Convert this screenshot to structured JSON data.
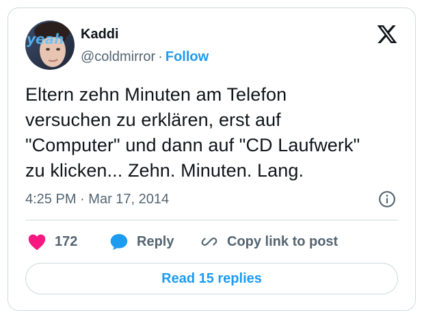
{
  "author": {
    "display_name": "Kaddi",
    "handle": "@coldmirror",
    "separator": "·",
    "follow_label": "Follow",
    "avatar_icon": "profile-photo",
    "avatar_text": "yeah"
  },
  "platform_icon": "x-logo-icon",
  "tweet": {
    "text": "Eltern zehn Minuten am Telefon\nversuchen zu erklären, erst auf\n\"Computer\" und dann auf \"CD Laufwerk\"\nzu klicken... Zehn. Minuten. Lang.",
    "time": "4:25 PM",
    "meta_separator": "·",
    "date": "Mar 17, 2014"
  },
  "actions": {
    "like_count": "172",
    "reply_label": "Reply",
    "copy_link_label": "Copy link to post"
  },
  "replies_button_label": "Read 15 replies",
  "colors": {
    "accent": "#1d9bf0",
    "like": "#f91880",
    "text": "#0f1419",
    "secondary": "#536471",
    "border": "#cfd9de"
  }
}
